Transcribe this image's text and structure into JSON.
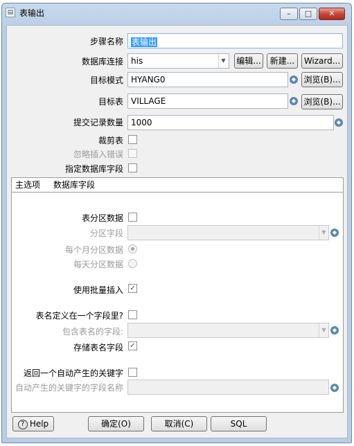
{
  "window": {
    "title": "表输出",
    "minimize": "–",
    "maximize": "□",
    "close": "✕"
  },
  "form": {
    "step_name_label": "步骤名称",
    "step_name_value": "表输出",
    "db_conn_label": "数据库连接",
    "db_conn_value": "his",
    "edit_btn": "编辑...",
    "new_btn": "新建...",
    "wizard_btn": "Wizard...",
    "target_schema_label": "目标模式",
    "target_schema_value": "HYANG0",
    "browse_btn_1": "浏览(B)...",
    "target_table_label": "目标表",
    "target_table_value": "VILLAGE",
    "browse_btn_2": "浏览(B)...",
    "commit_size_label": "提交记录数量",
    "commit_size_value": "1000",
    "truncate_label": "裁剪表",
    "ignore_errors_label": "忽略插入错误",
    "specify_fields_label": "指定数据库字段"
  },
  "tabs": {
    "main": "主选项",
    "db_fields": "数据库字段"
  },
  "main_tab": {
    "partition_label": "表分区数据",
    "partition_field_label": "分区字段",
    "monthly_label": "每个月分区数据",
    "daily_label": "每天分区数据",
    "batch_label": "使用批量插入",
    "batch_checked": "✓",
    "name_in_field_label": "表名定义在一个字段里?",
    "name_field_label": "包含表名的字段:",
    "store_name_label": "存储表名字段",
    "store_name_checked": "✓",
    "return_key_label": "返回一个自动产生的关键字",
    "key_field_label": "自动产生的关键字的字段名称"
  },
  "buttons": {
    "help": "Help",
    "ok": "确定(O)",
    "cancel": "取消(C)",
    "sql": "SQL"
  },
  "icons": {
    "variable": "◆",
    "dropdown": "▼",
    "help": "?"
  }
}
